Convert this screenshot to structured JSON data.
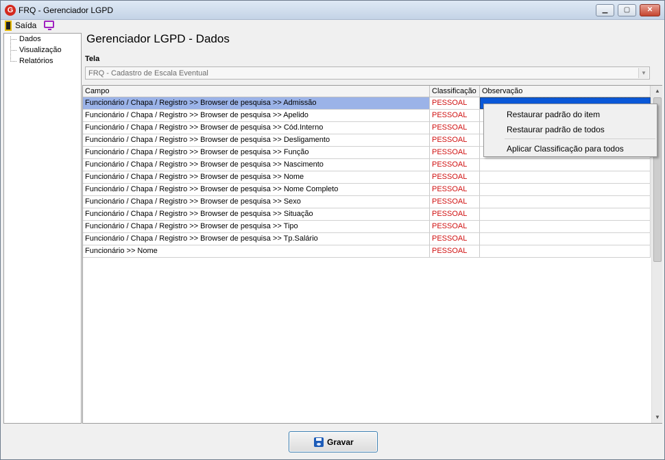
{
  "window": {
    "title": "FRQ - Gerenciador LGPD",
    "app_icon_letter": "G"
  },
  "menu": {
    "exit_label": "Saída"
  },
  "sidebar": {
    "items": [
      {
        "label": "Dados"
      },
      {
        "label": "Visualização"
      },
      {
        "label": "Relatórios"
      }
    ]
  },
  "main": {
    "title": "Gerenciador LGPD - Dados",
    "tela_label": "Tela",
    "tela_value": "FRQ - Cadastro de Escala Eventual"
  },
  "grid": {
    "headers": {
      "campo": "Campo",
      "classificacao": "Classificação",
      "observacao": "Observação"
    },
    "rows": [
      {
        "campo": "Funcionário / Chapa / Registro >> Browser de pesquisa >> Admissão",
        "classificacao": "PESSOAL",
        "observacao": ""
      },
      {
        "campo": "Funcionário / Chapa / Registro >> Browser de pesquisa >> Apelido",
        "classificacao": "PESSOAL",
        "observacao": ""
      },
      {
        "campo": "Funcionário / Chapa / Registro >> Browser de pesquisa >> Cód.Interno",
        "classificacao": "PESSOAL",
        "observacao": ""
      },
      {
        "campo": "Funcionário / Chapa / Registro >> Browser de pesquisa >> Desligamento",
        "classificacao": "PESSOAL",
        "observacao": ""
      },
      {
        "campo": "Funcionário / Chapa / Registro >> Browser de pesquisa >> Função",
        "classificacao": "PESSOAL",
        "observacao": ""
      },
      {
        "campo": "Funcionário / Chapa / Registro >> Browser de pesquisa >> Nascimento",
        "classificacao": "PESSOAL",
        "observacao": ""
      },
      {
        "campo": "Funcionário / Chapa / Registro >> Browser de pesquisa >> Nome",
        "classificacao": "PESSOAL",
        "observacao": ""
      },
      {
        "campo": "Funcionário / Chapa / Registro >> Browser de pesquisa >> Nome Completo",
        "classificacao": "PESSOAL",
        "observacao": ""
      },
      {
        "campo": "Funcionário / Chapa / Registro >> Browser de pesquisa >> Sexo",
        "classificacao": "PESSOAL",
        "observacao": ""
      },
      {
        "campo": "Funcionário / Chapa / Registro >> Browser de pesquisa >> Situação",
        "classificacao": "PESSOAL",
        "observacao": ""
      },
      {
        "campo": "Funcionário / Chapa / Registro >> Browser de pesquisa >> Tipo",
        "classificacao": "PESSOAL",
        "observacao": ""
      },
      {
        "campo": "Funcionário / Chapa / Registro >> Browser de pesquisa >> Tp.Salário",
        "classificacao": "PESSOAL",
        "observacao": ""
      },
      {
        "campo": "Funcionário >> Nome",
        "classificacao": "PESSOAL",
        "observacao": ""
      }
    ]
  },
  "context_menu": {
    "items": [
      {
        "label": "Restaurar padrão do item"
      },
      {
        "label": "Restaurar padrão de todos"
      },
      {
        "label": "Aplicar Classificação para todos"
      }
    ]
  },
  "footer": {
    "save_label": "Gravar"
  },
  "colors": {
    "selection": "#9bb3e8",
    "classification_text": "#d01010",
    "focus_cell": "#0a58d8"
  },
  "icons": [
    "app-logo-icon",
    "exit-door-icon",
    "monitor-icon",
    "disk-icon",
    "minimize-icon",
    "maximize-icon",
    "close-icon"
  ]
}
